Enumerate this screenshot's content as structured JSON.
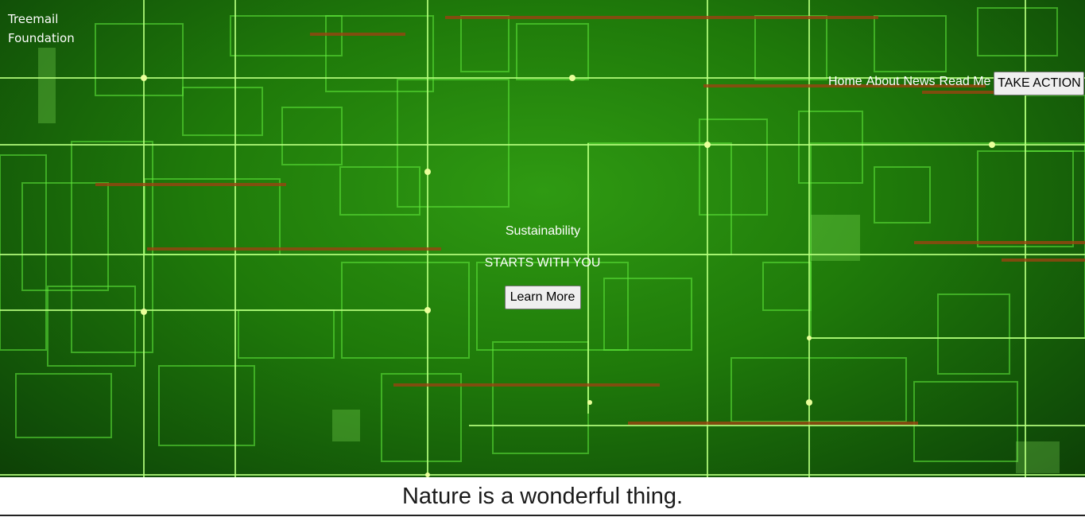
{
  "brand": {
    "line1": "Treemail",
    "line2": "Foundation"
  },
  "nav": {
    "items": [
      "Home",
      "About",
      "News",
      "Read Me"
    ],
    "cta_label": "TAKE ACTION"
  },
  "hero": {
    "tagline": "Sustainability",
    "headline": "STARTS WITH YOU",
    "button_label": "Learn More"
  },
  "section": {
    "heading": "Nature is a wonderful thing."
  },
  "colors": {
    "hero_green": "#1f7a0a",
    "line_green": "#7dff4a",
    "accent_brown": "#8a3b10"
  }
}
